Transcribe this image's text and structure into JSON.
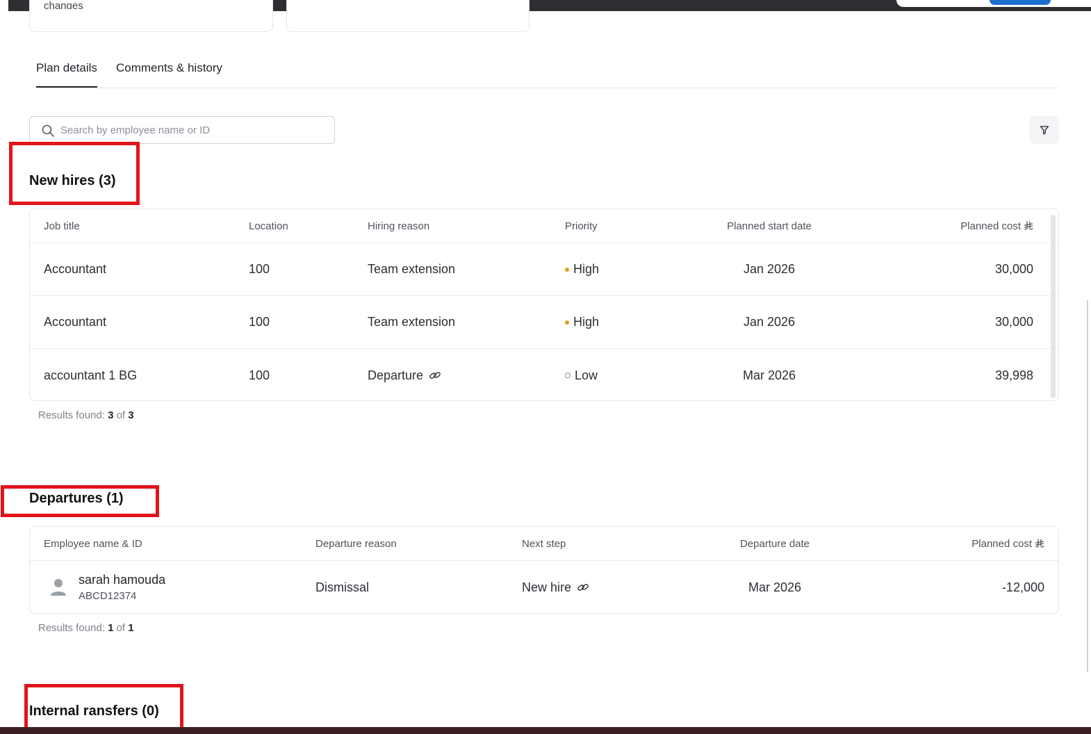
{
  "cards": {
    "fragment_text": "changes"
  },
  "tabs": [
    {
      "label": "Plan details",
      "active": true
    },
    {
      "label": "Comments & history",
      "active": false
    }
  ],
  "search": {
    "placeholder": "Search by employee name or ID"
  },
  "new_hires": {
    "title": "New hires (3)",
    "columns": [
      "Job title",
      "Location",
      "Hiring reason",
      "Priority",
      "Planned start date",
      "Planned cost"
    ],
    "rows": [
      {
        "job_title": "Accountant",
        "location": "100",
        "hiring_reason": "Team extension",
        "reason_link": false,
        "priority": "High",
        "start_date": "Jan 2026",
        "cost": "30,000"
      },
      {
        "job_title": "Accountant",
        "location": "100",
        "hiring_reason": "Team extension",
        "reason_link": false,
        "priority": "High",
        "start_date": "Jan 2026",
        "cost": "30,000"
      },
      {
        "job_title": "accountant 1 BG",
        "location": "100",
        "hiring_reason": "Departure",
        "reason_link": true,
        "priority": "Low",
        "start_date": "Mar 2026",
        "cost": "39,998"
      }
    ],
    "results": {
      "prefix": "Results found:",
      "shown": "3",
      "of": "of",
      "total": "3"
    }
  },
  "departures": {
    "title": "Departures (1)",
    "columns": [
      "Employee name & ID",
      "Departure reason",
      "Next step",
      "Departure date",
      "Planned cost"
    ],
    "rows": [
      {
        "name": "sarah hamouda",
        "id": "ABCD12374",
        "reason": "Dismissal",
        "next_step": "New hire",
        "date": "Mar 2026",
        "cost": "-12,000"
      }
    ],
    "results": {
      "prefix": "Results found:",
      "shown": "1",
      "of": "of",
      "total": "1"
    }
  },
  "internal_transfers": {
    "title": "Internal ransfers (0)"
  },
  "colors": {
    "highlight": "#e1141b",
    "priority_high": "#e89a1c",
    "priority_low": "#8b9099"
  },
  "icons": {
    "search": "search-icon",
    "filter": "filter-icon",
    "link": "link-icon",
    "currency": "riyal-currency-icon",
    "avatar": "person-icon"
  }
}
